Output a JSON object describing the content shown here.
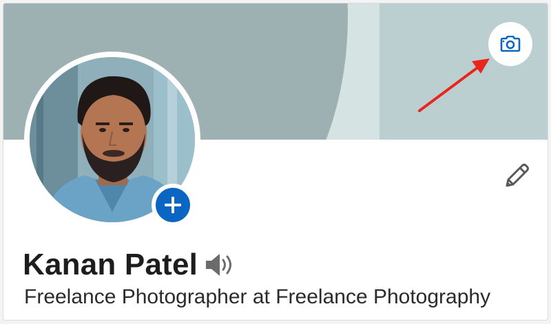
{
  "profile": {
    "name": "Kanan Patel",
    "headline": "Freelance Photographer at Freelance Photography"
  },
  "icons": {
    "camera": "camera-icon",
    "add": "plus-icon",
    "edit": "pencil-icon",
    "pronunciation": "speaker-icon",
    "annotation": "red-arrow"
  },
  "colors": {
    "accent": "#0a66c2",
    "annotation_arrow": "#e8261c",
    "banner": "#bccfd0"
  }
}
